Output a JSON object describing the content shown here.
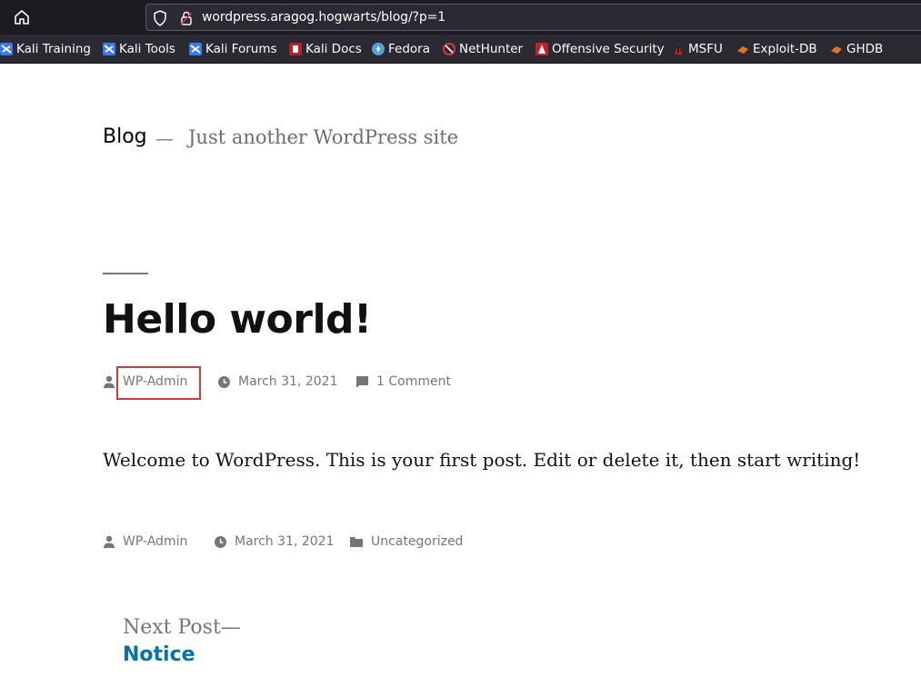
{
  "browser": {
    "url": "wordpress.aragog.hogwarts/blog/?p=1",
    "bookmarks": [
      {
        "label": "Kali Training",
        "icon": "kali-dragon-icon"
      },
      {
        "label": "Kali Tools",
        "icon": "kali-dragon-icon"
      },
      {
        "label": "Kali Forums",
        "icon": "kali-dragon-icon"
      },
      {
        "label": "Kali Docs",
        "icon": "kali-docs-icon"
      },
      {
        "label": "Fedora",
        "icon": "fedora-icon"
      },
      {
        "label": "NetHunter",
        "icon": "nethunter-icon"
      },
      {
        "label": "Offensive Security",
        "icon": "offsec-icon"
      },
      {
        "label": "MSFU",
        "icon": "msfu-icon"
      },
      {
        "label": "Exploit-DB",
        "icon": "exploitdb-icon"
      },
      {
        "label": "GHDB",
        "icon": "exploitdb-icon"
      }
    ]
  },
  "site": {
    "title": "Blog",
    "separator": "—",
    "description": "Just another WordPress site"
  },
  "post": {
    "title": "Hello world!",
    "author": "WP-Admin",
    "date": "March 31, 2021",
    "comments": "1 Comment",
    "body": "Welcome to WordPress. This is your first post. Edit or delete it, then start writing!",
    "footer": {
      "author": "WP-Admin",
      "date": "March 31, 2021",
      "category": "Uncategorized"
    }
  },
  "navigation": {
    "next_label": "Next Post—",
    "next_title": "Notice"
  },
  "colors": {
    "accent": "#0073aa",
    "meta": "#767676",
    "highlight": "#d23a3a"
  }
}
